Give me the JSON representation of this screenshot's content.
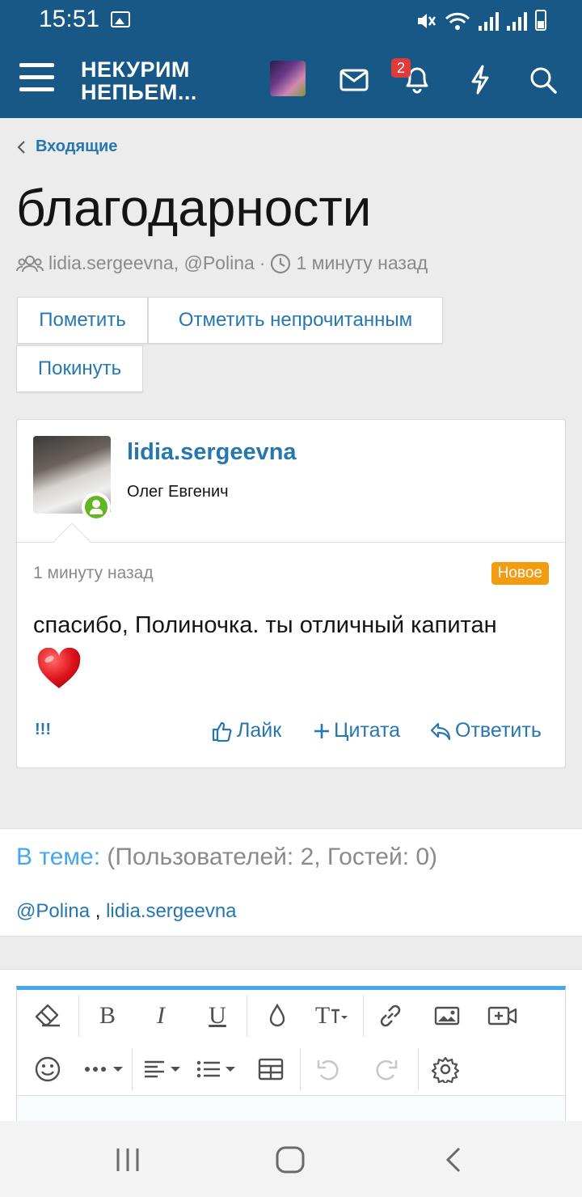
{
  "status_bar": {
    "time": "15:51"
  },
  "header": {
    "logo_line1": "НЕКУРИМ",
    "logo_line2": "НЕПЬЕМ...",
    "notifications_count": "2"
  },
  "breadcrumb": {
    "label": "Входящие"
  },
  "page": {
    "title": "благодарности",
    "participants": "lidia.sergeevna, @Polina",
    "separator": "·",
    "time": "1 минуту назад"
  },
  "actions": {
    "mark": "Пометить",
    "mark_unread": "Отметить непрочитанным",
    "leave": "Покинуть"
  },
  "message": {
    "username": "lidia.sergeevna",
    "user_title": "Олег Евгенич",
    "time": "1 минуту назад",
    "new_label": "Новое",
    "text": "спасибо, Полиночка. ты отличный капитан",
    "emoji_icon": "heart-icon",
    "report": "!!!",
    "like": "Лайк",
    "quote": "Цитата",
    "reply": "Ответить"
  },
  "in_thread": {
    "label": "В теме:",
    "counts": "(Пользователей: 2, Гостей: 0)",
    "user1": "@Polina",
    "sep": " , ",
    "user2": "lidia.sergeevna"
  },
  "editor_toolbar": {
    "row1": [
      "eraser-icon",
      "bold",
      "italic",
      "underline",
      "color-drop-icon",
      "text-size",
      "link-icon",
      "image-icon",
      "video-icon"
    ],
    "row2": [
      "smiley-icon",
      "more-icon",
      "align-icon",
      "list-icon",
      "table-icon",
      "undo-icon",
      "redo-icon",
      "settings-icon"
    ],
    "bold_label": "B",
    "italic_label": "I",
    "underline_label": "U",
    "textsize_label": "T"
  },
  "colors": {
    "brand": "#185886",
    "link": "#2577b1",
    "accent": "#47a7eb",
    "new_badge": "#f39c12",
    "notification_badge": "#e03b3b",
    "online": "#63b521"
  }
}
